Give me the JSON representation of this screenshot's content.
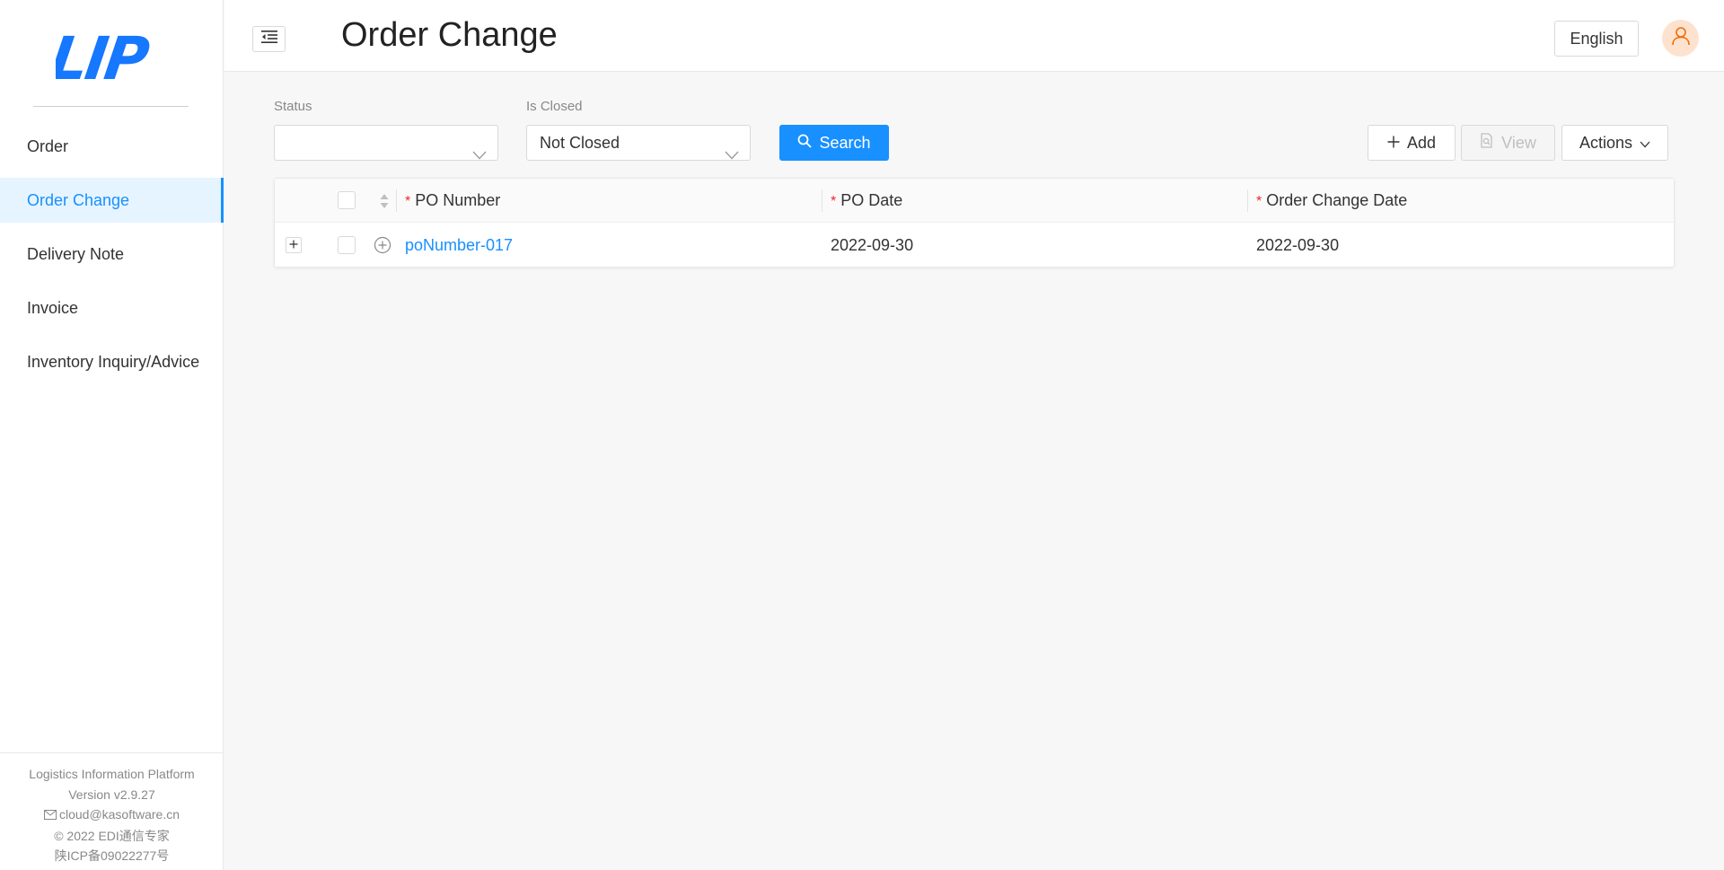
{
  "brand": {
    "logo_text": "LIP"
  },
  "sidebar": {
    "items": [
      {
        "label": "Order",
        "active": false
      },
      {
        "label": "Order Change",
        "active": true
      },
      {
        "label": "Delivery Note",
        "active": false
      },
      {
        "label": "Invoice",
        "active": false
      },
      {
        "label": "Inventory Inquiry/Advice",
        "active": false
      }
    ],
    "footer": {
      "platform": "Logistics Information Platform",
      "version": "Version v2.9.27",
      "email": "cloud@kasoftware.cn",
      "copyright": "© 2022 EDI通信专家",
      "icp": "陕ICP备09022277号"
    }
  },
  "header": {
    "title": "Order Change",
    "language": "English"
  },
  "filters": {
    "status": {
      "label": "Status",
      "value": ""
    },
    "is_closed": {
      "label": "Is Closed",
      "value": "Not Closed"
    }
  },
  "toolbar": {
    "search_label": "Search",
    "add_label": "Add",
    "view_label": "View",
    "actions_label": "Actions"
  },
  "table": {
    "columns": [
      "PO Number",
      "PO Date",
      "Order Change Date"
    ],
    "rows": [
      {
        "po_number": "poNumber-017",
        "po_date": "2022-09-30",
        "order_change_date": "2022-09-30"
      }
    ]
  },
  "colors": {
    "primary": "#1890ff",
    "required": "#f5222d",
    "avatar_bg": "#fde3cf",
    "avatar_icon": "#f56a00"
  }
}
